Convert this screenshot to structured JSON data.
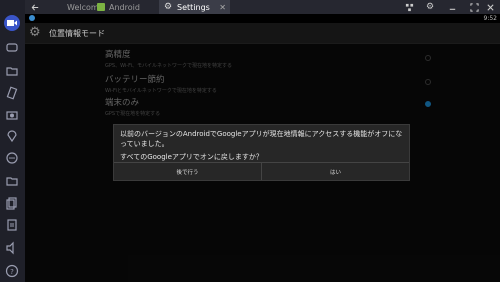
{
  "tabs": [
    {
      "label": "Welcome"
    },
    {
      "label": "Android"
    },
    {
      "label": "Settings"
    }
  ],
  "status": {
    "time": "9:52"
  },
  "header": {
    "title": "位置情報モード"
  },
  "options": [
    {
      "title": "高精度",
      "subtitle": "GPS、Wi-Fi、モバイルネットワークで現在地を特定する"
    },
    {
      "title": "バッテリー節約",
      "subtitle": "Wi-Fiとモバイルネットワークで現在地を特定する"
    },
    {
      "title": "端末のみ",
      "subtitle": "GPSで現在地を特定する"
    }
  ],
  "dialog": {
    "message": "以前のバージョンのAndroidでGoogleアプリが現在地情報にアクセスする機能がオフになっていました。",
    "question": "すべてのGoogleアプリでオンに戻しますか？",
    "cancel": "後で行う",
    "ok": "はい"
  },
  "colors": {
    "accent": "#1b86c9",
    "sidebar_active": "#3a55c8"
  }
}
